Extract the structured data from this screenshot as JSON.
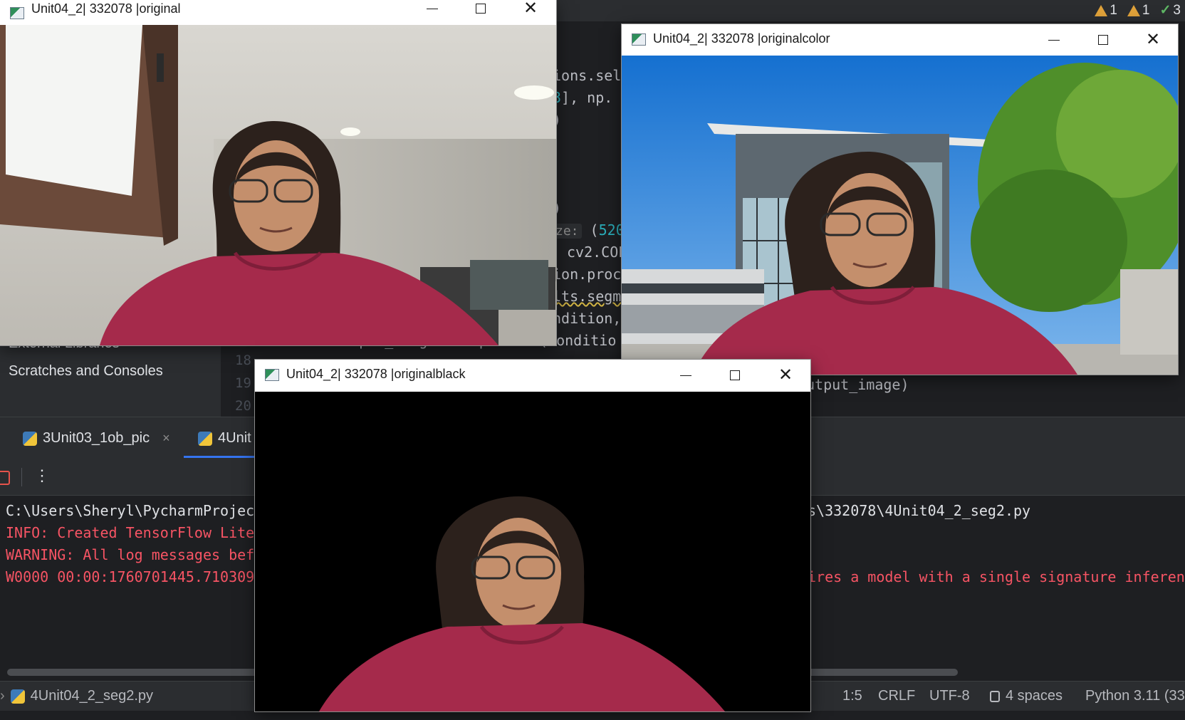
{
  "ide": {
    "inspections": {
      "warnings_a": "1",
      "warnings_b": "1",
      "ok": "3"
    },
    "code_lines": [
      "ions.sel",
      "3], np.",
      ")",
      ")",
      "(520,",
      "cv2.COL",
      "ion.proc",
      "lts.segm",
      "ndition,",
      "output_image2 = np.where(conditio"
    ],
    "code_hint": "ze:",
    "code_right": "utput_image)",
    "gutter_lines": [
      "18",
      "19",
      "20"
    ],
    "project_items": [
      "External Libraries",
      "Scratches and Consoles"
    ],
    "run_tabs": [
      {
        "label": "3Unit03_1ob_pic",
        "close": "×"
      },
      {
        "label": "4Unit"
      }
    ],
    "toolbar_more": "⋮",
    "console_lines": [
      {
        "left": "C:\\Users\\Sheryl\\PycharmProjec",
        "right": "s\\332078\\4Unit04_2_seg2.py",
        "type": "white"
      },
      {
        "left": "INFO: Created TensorFlow Lite",
        "right": "",
        "type": "red"
      },
      {
        "left": "WARNING: All log messages bef",
        "right": "",
        "type": "red"
      },
      {
        "left": "W0000 00:00:1760701445.710309",
        "right": "ires a model with a single signature inferen",
        "type": "red"
      }
    ],
    "status": {
      "file": "4Unit04_2_seg2.py",
      "position": "1:5",
      "line_sep": "CRLF",
      "encoding": "UTF-8",
      "indent": "4 spaces",
      "interpreter": "Python 3.11 (33"
    }
  },
  "windows": {
    "original": {
      "title": "Unit04_2| 332078 |original"
    },
    "originalcolor": {
      "title": "Unit04_2| 332078 |originalcolor"
    },
    "originalblack": {
      "title": "Unit04_2| 332078 |originalblack"
    }
  },
  "colors": {
    "ide_bg": "#1e1f22",
    "panel_bg": "#2b2d30",
    "console_red": "#f75464",
    "number_teal": "#2aacb8",
    "hoodie": "#a52a4b",
    "sky": "#1f7fd6",
    "tree": "#4f8f2a"
  },
  "icons": [
    "warning-icon",
    "check-icon",
    "python-file-icon",
    "stop-icon",
    "more-icon",
    "minimize-icon",
    "maximize-icon",
    "close-icon",
    "window-app-icon"
  ]
}
